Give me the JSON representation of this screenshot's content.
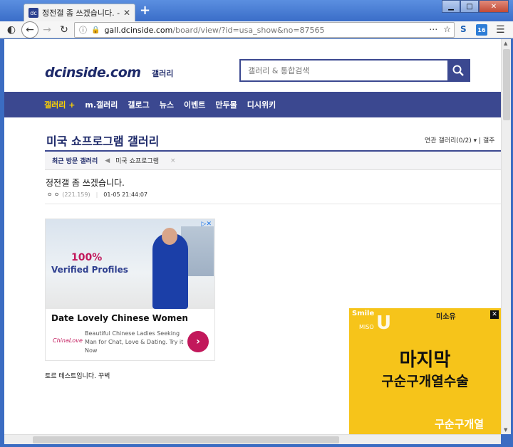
{
  "browser": {
    "tab_title": "정전갤 좀 쓰겠습니다. - 미국 쇼",
    "tab_favicon": "dc",
    "new_tab": "+",
    "url_host": "gall.dcinside.com",
    "url_path": "/board/view/?id=usa_show&no=87565",
    "url_prefix": "",
    "ext_s": "S",
    "ext_badge": "16"
  },
  "site": {
    "logo": "dcinside.com",
    "logo_sub": "갤러리",
    "search_placeholder": "갤러리 & 통합검색"
  },
  "gnb": {
    "items": [
      "갤러리 +",
      "m.갤러리",
      "갤로그",
      "뉴스",
      "이벤트",
      "만두몰",
      "디시위키"
    ]
  },
  "gallery": {
    "title": "미국 쇼프로그램 갤러리",
    "related": "연관 갤러리(0/2)  ▾  |  갤주",
    "recent_label": "최근 방문 갤러리",
    "recent_item": "미국 쇼프로그램",
    "recent_close": "×"
  },
  "post": {
    "title": "정전갤 좀 쓰겠습니다.",
    "author": "ㅇ ㅇ",
    "ip": "(221.159)",
    "date": "01-05 21:44:07",
    "body": "토르 테스트입니다. 꾸벅"
  },
  "ad1": {
    "choices": "▷✕",
    "percent": "100%",
    "verified": "Verified Profiles",
    "headline": "Date Lovely Chinese Women",
    "logo": "ChinaLove",
    "body": "Beautiful Chinese Ladies Seeking Man for Chat, Love & Dating. Try it Now",
    "cta": "›"
  },
  "ad2": {
    "brand": "Smile",
    "miso": "MISO",
    "u": "U",
    "right": "미소유",
    "close": "✕",
    "headline1": "마지막",
    "headline2": "구순구개열수술",
    "footer": "구순구개열"
  }
}
